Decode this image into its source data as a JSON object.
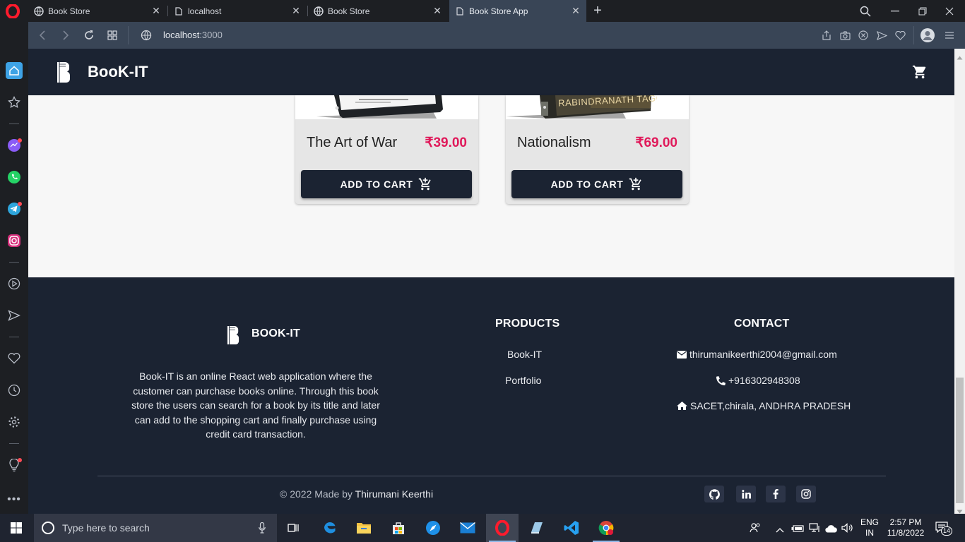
{
  "browser": {
    "tabs": [
      {
        "title": "Book Store",
        "active": false
      },
      {
        "title": "localhost",
        "active": false
      },
      {
        "title": "Book Store",
        "active": false
      },
      {
        "title": "Book Store App",
        "active": true
      }
    ],
    "url_host": "localhost",
    "url_port": ":3000"
  },
  "app": {
    "brand": "BooK-IT"
  },
  "products": [
    {
      "title": "The Art of War",
      "price": "₹39.00",
      "button": "ADD TO CART",
      "cover_text": ""
    },
    {
      "title": "Nationalism",
      "price": "₹69.00",
      "button": "ADD TO CART",
      "cover_text": "RABINDRANATH TAGORE"
    }
  ],
  "footer": {
    "brand": "BOOK-IT",
    "about": "Book-IT is an online React web application where the customer can purchase books online. Through this book store the users can search for a book by its title and later can add to the shopping cart and finally purchase using credit card transaction.",
    "products_heading": "PRODUCTS",
    "products_links": [
      "Book-IT",
      "Portfolio"
    ],
    "contact_heading": "CONTACT",
    "email": "thirumanikeerthi2004@gmail.com",
    "phone": "+916302948308",
    "address": "SACET,chirala, ANDHRA PRADESH",
    "copyright_prefix": "© 2022 Made by",
    "copyright_name": "Thirumani Keerthi",
    "social_icons": [
      "github-icon",
      "linkedin-icon",
      "facebook-icon",
      "instagram-icon"
    ]
  },
  "taskbar": {
    "search_placeholder": "Type here to search",
    "language_top": "ENG",
    "language_bottom": "IN",
    "time": "2:57 PM",
    "date": "11/8/2022",
    "notification_count": "14"
  },
  "colors": {
    "header_bg": "#1b2332",
    "price": "#e0195a",
    "page_bg": "#f7f7f7"
  }
}
